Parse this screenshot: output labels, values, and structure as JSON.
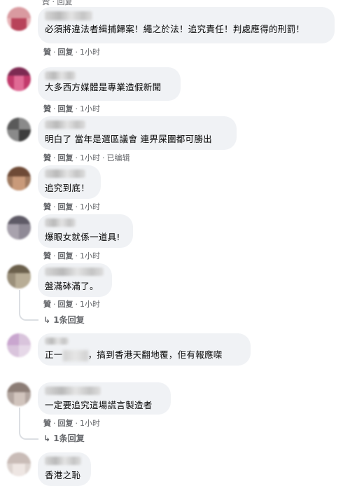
{
  "top_clip": "贊 · 回复",
  "actions": {
    "like": "贊",
    "reply": "回复",
    "separator": "·"
  },
  "comments": [
    {
      "text": "必須將違法者緝捕歸案！繩之於法！追究責任！判處應得的刑罰！",
      "time": "1小时",
      "edited": ""
    },
    {
      "text": "大多西方媒體是專業造假新聞",
      "time": "1小时",
      "edited": ""
    },
    {
      "text": "明白了 當年是選區議會 連畀屎圍都可勝出",
      "time": "1小时",
      "edited": "已编辑"
    },
    {
      "text": "追究到底！",
      "time": "1小时",
      "edited": ""
    },
    {
      "text": "爆眼女就係一道具!",
      "time": "1小时",
      "edited": ""
    },
    {
      "text": "盤滿砵滿了。",
      "time": "1小时",
      "edited": "",
      "replies": "1条回复"
    },
    {
      "text_before": "正一",
      "text_after": "，搞到香港天翻地覆，佢有報應㗎",
      "time": "",
      "edited": ""
    },
    {
      "text": "一定要追究這場謊言製造者",
      "time": "1小时",
      "edited": "",
      "replies": "1条回复"
    },
    {
      "text": "香港之恥",
      "time": "",
      "edited": ""
    }
  ]
}
